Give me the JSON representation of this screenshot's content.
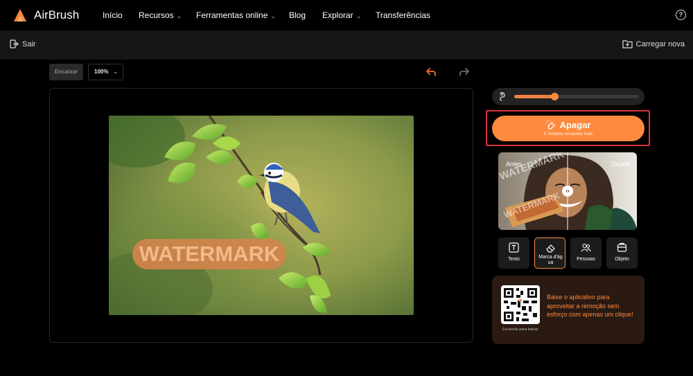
{
  "nav": {
    "brand": "AirBrush",
    "items": [
      {
        "label": "Início",
        "has_menu": false
      },
      {
        "label": "Recursos",
        "has_menu": true
      },
      {
        "label": "Ferramentas online",
        "has_menu": true
      },
      {
        "label": "Blog",
        "has_menu": false
      },
      {
        "label": "Explorar",
        "has_menu": true
      },
      {
        "label": "Transferências",
        "has_menu": false
      }
    ],
    "help_glyph": "?"
  },
  "subbar": {
    "exit_label": "Sair",
    "upload_label": "Carregar nova"
  },
  "toolbar": {
    "fit_label": "Encaixar",
    "zoom_value": "100%"
  },
  "canvas": {
    "watermark_text": "WATERMARK"
  },
  "panel": {
    "brush_size": 0.32,
    "erase_label": "Apagar",
    "erase_sub": "5 Tempos restantes hoje",
    "compare_before": "Antes",
    "compare_after": "Depois",
    "compare_watermark": "WATERMARK",
    "tools": [
      {
        "label": "Texto",
        "icon": "text-icon",
        "active": false
      },
      {
        "label": "Marca d'ág ua",
        "icon": "eraser-icon",
        "active": true
      },
      {
        "label": "Pessoas",
        "icon": "people-icon",
        "active": false
      },
      {
        "label": "Objeto",
        "icon": "object-icon",
        "active": false
      }
    ],
    "promo_caption": "Escanele para baixar",
    "promo_text": "Baixe o aplicativo para aproveitar a remoção sem esforço com apenas um clique!"
  },
  "colors": {
    "accent": "#ff8a3d",
    "highlight": "#d9343a",
    "background": "#000000",
    "panel": "#161616"
  }
}
